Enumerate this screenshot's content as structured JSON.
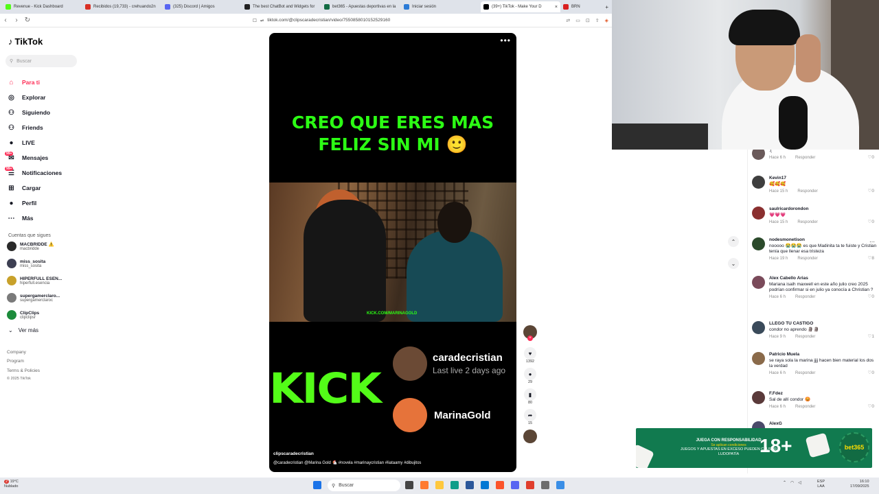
{
  "browser": {
    "tabs": [
      {
        "title": "Revenue - Kick Dashboard",
        "color": "#53fc18"
      },
      {
        "title": "Recibidos (19,733) - crehuando2n",
        "color": "#d93025"
      },
      {
        "title": "(325) Discord | Amigos",
        "color": "#5865f2"
      },
      {
        "title": "The best ChatBot and Widgets for",
        "color": "#222222"
      },
      {
        "title": "bet365 - Apuestas deportivas en la",
        "color": "#126b43"
      },
      {
        "title": "Iniciar sesión",
        "color": "#2b7bd6"
      },
      {
        "title": "(39+) TikTok - Make Your D",
        "color": "#000000",
        "active": true
      },
      {
        "title": "BRN",
        "color": "#d92020"
      }
    ],
    "close_label": "×",
    "new_tab_label": "+",
    "url": "tiktok.com/@clipscaradecristian/video/7550858010152529160"
  },
  "sidebar": {
    "logo": "TikTok",
    "search_placeholder": "Buscar",
    "menu": [
      {
        "label": "Para ti",
        "icon": "⌂",
        "active": true
      },
      {
        "label": "Explorar",
        "icon": "◎"
      },
      {
        "label": "Siguiendo",
        "icon": "⚇"
      },
      {
        "label": "Friends",
        "icon": "⚇"
      },
      {
        "label": "LIVE",
        "icon": "●"
      },
      {
        "label": "Mensajes",
        "icon": "✉",
        "badge": "99+"
      },
      {
        "label": "Notificaciones",
        "icon": "☰",
        "badge": "99+"
      },
      {
        "label": "Cargar",
        "icon": "⊞"
      },
      {
        "label": "Perfil",
        "icon": "●"
      },
      {
        "label": "Más",
        "icon": "⋯"
      }
    ],
    "following_title": "Cuentas que sigues",
    "following": [
      {
        "name": "MACBRIDDE ⚠️",
        "handle": "macbridde",
        "color": "#2a2a2a"
      },
      {
        "name": "miss_sosita",
        "handle": "miss_sosita",
        "color": "#3d3f52"
      },
      {
        "name": "HIPERFULL ESEN...",
        "handle": "hiperfull.esencia",
        "color": "#c8a12a"
      },
      {
        "name": "supergamerclaro...",
        "handle": "supergamerclaroc",
        "color": "#7a7a7a"
      },
      {
        "name": "ClipClips",
        "handle": "clipclipsr",
        "color": "#1c8b3b"
      }
    ],
    "see_more": "Ver más",
    "footer": [
      "Company",
      "Program",
      "Terms & Policies",
      "© 2025 TikTok"
    ]
  },
  "video": {
    "more_icon": "•••",
    "caption": "CREO QUE ERES MAS FELIZ SIN MI 🙂",
    "scene_tag": "KICK.COM/MARINAGOLD",
    "kick_logo": "KICK",
    "streamers": [
      {
        "name": "caradecristian",
        "status": "Last live 2 days ago",
        "color": "#6b4a35"
      },
      {
        "name": "MarinaGold",
        "status": "",
        "color": "#e6733a"
      }
    ],
    "author": "clipscaradecristian",
    "mentions": "@caradecristian @Marina Gold 🐔",
    "hashtags": "#novela #marinaycristian #liataamy #dibujitos"
  },
  "actions": {
    "likes": "1392",
    "comments": "29",
    "saves": "80",
    "shares": "15"
  },
  "comments": [
    {
      "name": "",
      "text": ":(",
      "time": "Hace 6 h",
      "reply": "Responder",
      "likes": "0",
      "color": "#6a5a5a"
    },
    {
      "name": "Kevin17",
      "text": "🥰🥰🥰",
      "time": "Hace 15 h",
      "reply": "Responder",
      "likes": "0",
      "color": "#3e3e3e"
    },
    {
      "name": "saulricardorondon",
      "text": "💗💗💗",
      "time": "Hace 15 h",
      "reply": "Responder",
      "likes": "0",
      "color": "#8a2f2f"
    },
    {
      "name": "nodesmonetison",
      "text": "nooooo 😭😭😭 es que Madinita ta te fuiste y Cristian tenía que llenar esa tristeza",
      "time": "Hace 19 h",
      "reply": "Responder",
      "likes": "8",
      "color": "#2b4a2b"
    },
    {
      "name": "Alex Cabello Arias",
      "text": "Mariana isaih maxwell en este año julio creo 2025 podrían confirmar si en julio ya conocía a Christian ?",
      "time": "Hace 6 h",
      "reply": "Responder",
      "likes": "0",
      "color": "#7a4a5a"
    },
    {
      "name": "LLEGO TU CASTIGO",
      "text": "condor no aprendo 🗿🗿",
      "time": "Hace 9 h",
      "reply": "Responder",
      "likes": "1",
      "color": "#3a4a5a"
    },
    {
      "name": "Patricio Muela",
      "text": "se raya sola la marina jjjj hacen bien material los dos la verdad",
      "time": "Hace 6 h",
      "reply": "Responder",
      "likes": "0",
      "color": "#8a6a4a"
    },
    {
      "name": "F.Fdez",
      "text": "Sal de allí condor 😡",
      "time": "Hace 6 h",
      "reply": "Responder",
      "likes": "0",
      "color": "#5a3a3a"
    },
    {
      "name": "AlexG",
      "text": "",
      "time": "",
      "reply": "",
      "likes": "",
      "color": "#4a4a6a"
    }
  ],
  "ad": {
    "title": "JUEGA CON RESPONSABILIDAD",
    "subtitle": "Se aplican condiciones",
    "warning": "JUEGOS Y APUESTAS EN EXCESO PUEDEN CAUSAR LUDOPATÍA",
    "age": "18+",
    "brand": "bet365"
  },
  "taskbar": {
    "weather_temp": "19°C",
    "weather_desc": "Nublado",
    "weather_badge": "2",
    "search_label": "Buscar",
    "lang": "ESP",
    "region": "LAA",
    "time": "16:10",
    "date": "17/09/2025"
  }
}
